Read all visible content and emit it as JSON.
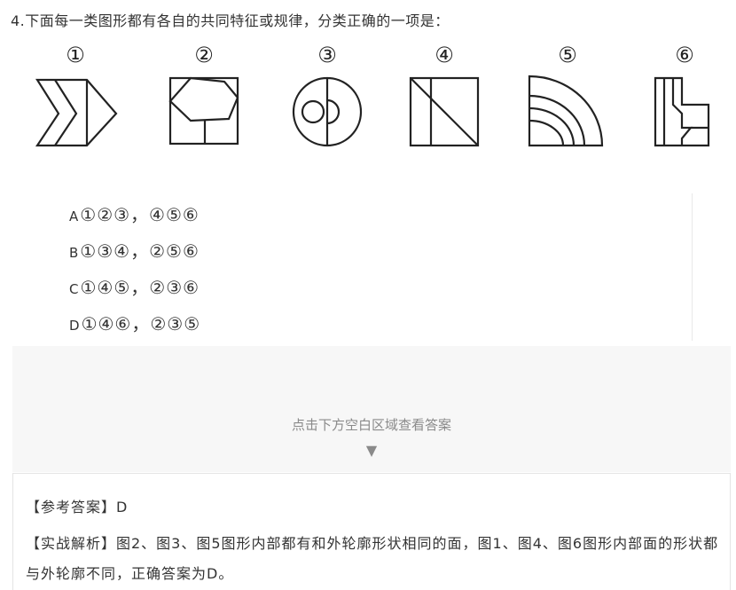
{
  "question": {
    "text": "4.下面每一类图形都有各自的共同特征或规律，分类正确的一项是："
  },
  "figures": {
    "labels": [
      "①",
      "②",
      "③",
      "④",
      "⑤",
      "⑥"
    ]
  },
  "options": [
    {
      "letter": "A",
      "text": "①②③，④⑤⑥"
    },
    {
      "letter": "B",
      "text": "①③④，②⑤⑥"
    },
    {
      "letter": "C",
      "text": "①④⑤，②③⑥"
    },
    {
      "letter": "D",
      "text": "①④⑥，②③⑤"
    }
  ],
  "reveal": {
    "prompt": "点击下方空白区域查看答案",
    "arrow": "▼"
  },
  "answer": {
    "reference": "【参考答案】D",
    "analysis": "【实战解析】图2、图3、图5图形内部都有和外轮廓形状相同的面，图1、图4、图6图形内部面的形状都与外轮廓不同，正确答案为D。"
  }
}
